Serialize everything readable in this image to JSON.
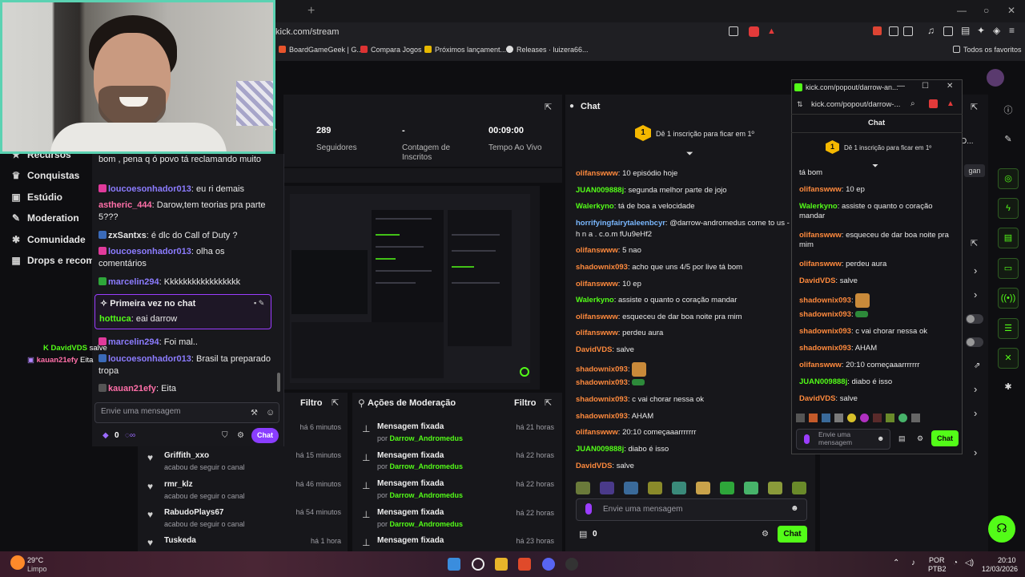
{
  "browser": {
    "url": "kick.com/stream",
    "bookmarks": [
      "BoardGameGeek | G...",
      "Compara Jogos",
      "Próximos lançament...",
      "Releases · luizera66..."
    ],
    "other_bookmarks": "Todos os favoritos"
  },
  "nav": {
    "items": [
      {
        "label": "Recursos",
        "icon": "star-icon"
      },
      {
        "label": "Conquistas",
        "icon": "trophy-icon"
      },
      {
        "label": "Estúdio",
        "icon": "studio-icon"
      },
      {
        "label": "Moderation",
        "icon": "wrench-icon"
      },
      {
        "label": "Comunidade",
        "icon": "community-icon"
      },
      {
        "label": "Drops e recomp",
        "icon": "drops-icon"
      }
    ]
  },
  "stats": {
    "followers_value": "289",
    "followers_label": "Seguidores",
    "subs_value": "-",
    "subs_label": "Contagem de Inscritos",
    "live_value": "00:09:00",
    "live_label": "Tempo Ao Vivo"
  },
  "followers_panel": {
    "filter": "Filtro",
    "rows": [
      {
        "name": "",
        "sub": "",
        "time": "há 6 minutos"
      },
      {
        "name": "Griffith_xxo",
        "sub": "acabou de seguir o canal",
        "time": "há 15 minutos"
      },
      {
        "name": "rmr_klz",
        "sub": "acabou de seguir o canal",
        "time": "há 46 minutos"
      },
      {
        "name": "RabudoPlays67",
        "sub": "acabou de seguir o canal",
        "time": "há 54 minutos"
      },
      {
        "name": "Tuskeda",
        "sub": "",
        "time": "há 1 hora"
      }
    ]
  },
  "mod_panel": {
    "title": "Ações de Moderação",
    "filter": "Filtro",
    "rows": [
      {
        "action": "Mensagem fixada",
        "by": "por",
        "user": "Darrow_Andromedus",
        "time": "há 21 horas"
      },
      {
        "action": "Mensagem fixada",
        "by": "por",
        "user": "Darrow_Andromedus",
        "time": "há 22 horas"
      },
      {
        "action": "Mensagem fixada",
        "by": "por",
        "user": "Darrow_Andromedus",
        "time": "há 22 horas"
      },
      {
        "action": "Mensagem fixada",
        "by": "por",
        "user": "Darrow_Andromedus",
        "time": "há 22 horas"
      },
      {
        "action": "Mensagem fixada",
        "by": "",
        "user": "",
        "time": "há 23 horas"
      }
    ]
  },
  "chat": {
    "title": "Chat",
    "sub_prompt": "Dê 1 inscrição para ficar em 1º",
    "sub_rank": "1",
    "messages": [
      {
        "user": "olifanswww",
        "color": "orange",
        "text": "10 episódio hoje"
      },
      {
        "user": "JUAN009888j",
        "color": "green",
        "text": "segunda melhor parte de jojo"
      },
      {
        "user": "Walerkyno",
        "color": "green",
        "text": "tá de boa a velocidade"
      },
      {
        "user": "horrifyingfairytaleenbcyr",
        "color": "cyan",
        "text": "@darrow-andromedus come to us - n"
      },
      {
        "user": "",
        "color": "cyan",
        "text": "h n a . c.o.m fUu9eHf2"
      },
      {
        "user": "olifanswww",
        "color": "orange",
        "text": "5 nao"
      },
      {
        "user": "shadownix093",
        "color": "orange",
        "text": "acho que uns 4/5 por live tá bom"
      },
      {
        "user": "olifanswww",
        "color": "orange",
        "text": "10 ep"
      },
      {
        "user": "Walerkyno",
        "color": "green",
        "text": "assiste o quanto o coração mandar"
      },
      {
        "user": "olifanswww",
        "color": "orange",
        "text": "esqueceu de dar boa noite pra mim"
      },
      {
        "user": "olifanswww",
        "color": "orange",
        "text": "perdeu aura"
      },
      {
        "user": "DavidVDS",
        "color": "orange",
        "text": "salve"
      },
      {
        "user": "shadownix093",
        "color": "orange",
        "text": ""
      },
      {
        "user": "shadownix093",
        "color": "orange",
        "text": ""
      },
      {
        "user": "shadownix093",
        "color": "orange",
        "text": "c vai chorar nessa ok"
      },
      {
        "user": "shadownix093",
        "color": "orange",
        "text": "AHAM"
      },
      {
        "user": "olifanswww",
        "color": "orange",
        "text": "20:10 começaaarrrrrrr"
      },
      {
        "user": "JUAN009888j",
        "color": "green",
        "text": "diabo é isso"
      },
      {
        "user": "DavidVDS",
        "color": "orange",
        "text": "salve"
      }
    ],
    "input_placeholder": "Envie uma mensagem",
    "points": "0",
    "send_label": "Chat"
  },
  "popout": {
    "title": "kick.com/popout/darrow-an...",
    "url": "kick.com/popout/darrow-...",
    "header": "Chat",
    "sub_prompt": "Dê 1 inscrição para ficar em 1º",
    "sub_rank": "1",
    "messages": [
      {
        "user": "",
        "color": "orange",
        "text": "tá bom"
      },
      {
        "user": "olifanswww",
        "color": "orange",
        "text": "10 ep"
      },
      {
        "user": "Walerkyno",
        "color": "green",
        "text": "assiste o quanto o coração mandar"
      },
      {
        "user": "olifanswww",
        "color": "orange",
        "text": "esqueceu de dar boa noite pra mim"
      },
      {
        "user": "olifanswww",
        "color": "orange",
        "text": "perdeu aura"
      },
      {
        "user": "DavidVDS",
        "color": "orange",
        "text": "salve"
      },
      {
        "user": "shadownix093",
        "color": "orange",
        "text": ""
      },
      {
        "user": "shadownix093",
        "color": "orange",
        "text": ""
      },
      {
        "user": "shadownix093",
        "color": "orange",
        "text": "c vai chorar nessa ok"
      },
      {
        "user": "shadownix093",
        "color": "orange",
        "text": "AHAM"
      },
      {
        "user": "olifanswww",
        "color": "orange",
        "text": "20:10 começaaarrrrrrr"
      },
      {
        "user": "JUAN009888j",
        "color": "green",
        "text": "diabo é isso"
      },
      {
        "user": "DavidVDS",
        "color": "orange",
        "text": "salve"
      }
    ],
    "input_placeholder": "Envie uma mensagem",
    "send_label": "Chat"
  },
  "overlay": {
    "messages": [
      {
        "user": "",
        "color": "white",
        "text": "bom , pena q ó povo tá reclamando muito"
      },
      {
        "user": "loucoesonhador013",
        "color": "purple",
        "text": "eu ri demais"
      },
      {
        "user": "astheric_444",
        "color": "pink",
        "text": "Darow,tem teorias pra parte 5???"
      },
      {
        "user": "zxSantxs",
        "color": "white",
        "text": "é dlc do Call of Duty ?"
      },
      {
        "user": "loucoesonhador013",
        "color": "purple",
        "text": "olha os comentários"
      },
      {
        "user": "marcelin294",
        "color": "purple",
        "text": "Kkkkkkkkkkkkkkkkk"
      },
      {
        "user": "marcelin294",
        "color": "purple",
        "text": "Foi mal.."
      },
      {
        "user": "loucoesonhador013",
        "color": "purple",
        "text": "Brasil ta preparado tropa"
      },
      {
        "user": "kauan21efy",
        "color": "pink",
        "text": "Eita"
      }
    ],
    "first_time_label": "Primeira vez no chat",
    "first_time_user": "hottuca",
    "first_time_text": "eai darrow",
    "input_placeholder": "Envie uma mensagem",
    "points": "0",
    "send_label": "Chat",
    "side_msgs": [
      {
        "user": "DavidVDS",
        "text": "salve"
      },
      {
        "user": "kauan21efy",
        "text": "Eita"
      }
    ]
  },
  "right_panel": {
    "partial_text": "D...",
    "tag": "gan"
  },
  "taskbar": {
    "weather_temp": "29°C",
    "weather_desc": "Limpo",
    "lang_top": "POR",
    "lang_bottom": "PTB2",
    "time": "20:10",
    "date": "12/03/2026"
  },
  "colors": {
    "accent": "#53fc18",
    "highlight": "#9b3dff",
    "orange": "#ff8a3d"
  }
}
